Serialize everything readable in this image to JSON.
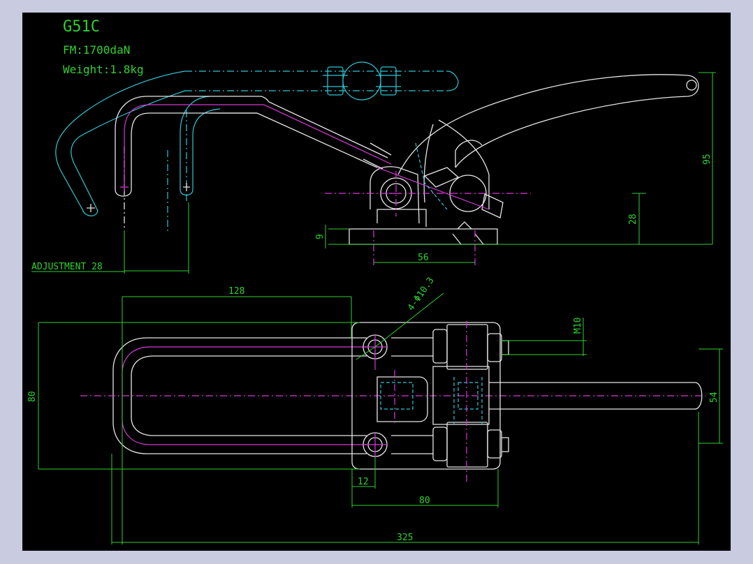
{
  "header": {
    "model": "G51C",
    "force": "FM:1700daN",
    "weight": "Weight:1.8kg"
  },
  "dimensions": {
    "adjustment": "ADJUSTMENT 28",
    "base_thickness": "9",
    "base_width": "56",
    "pivot_height": "28",
    "total_height": "95",
    "hook_length": "128",
    "holes": "4-Φ10.3",
    "thread": "M10",
    "total_width": "80",
    "handle_width": "54",
    "hole_offset": "12",
    "base_length": "80",
    "total_length": "325"
  },
  "colors": {
    "background": "#000000",
    "frame": "#c9cbe0",
    "outline": "#e6e6e6",
    "centerline": "#d838d8",
    "alt_position": "#2fc6d6",
    "dimension": "#2fd12f"
  }
}
